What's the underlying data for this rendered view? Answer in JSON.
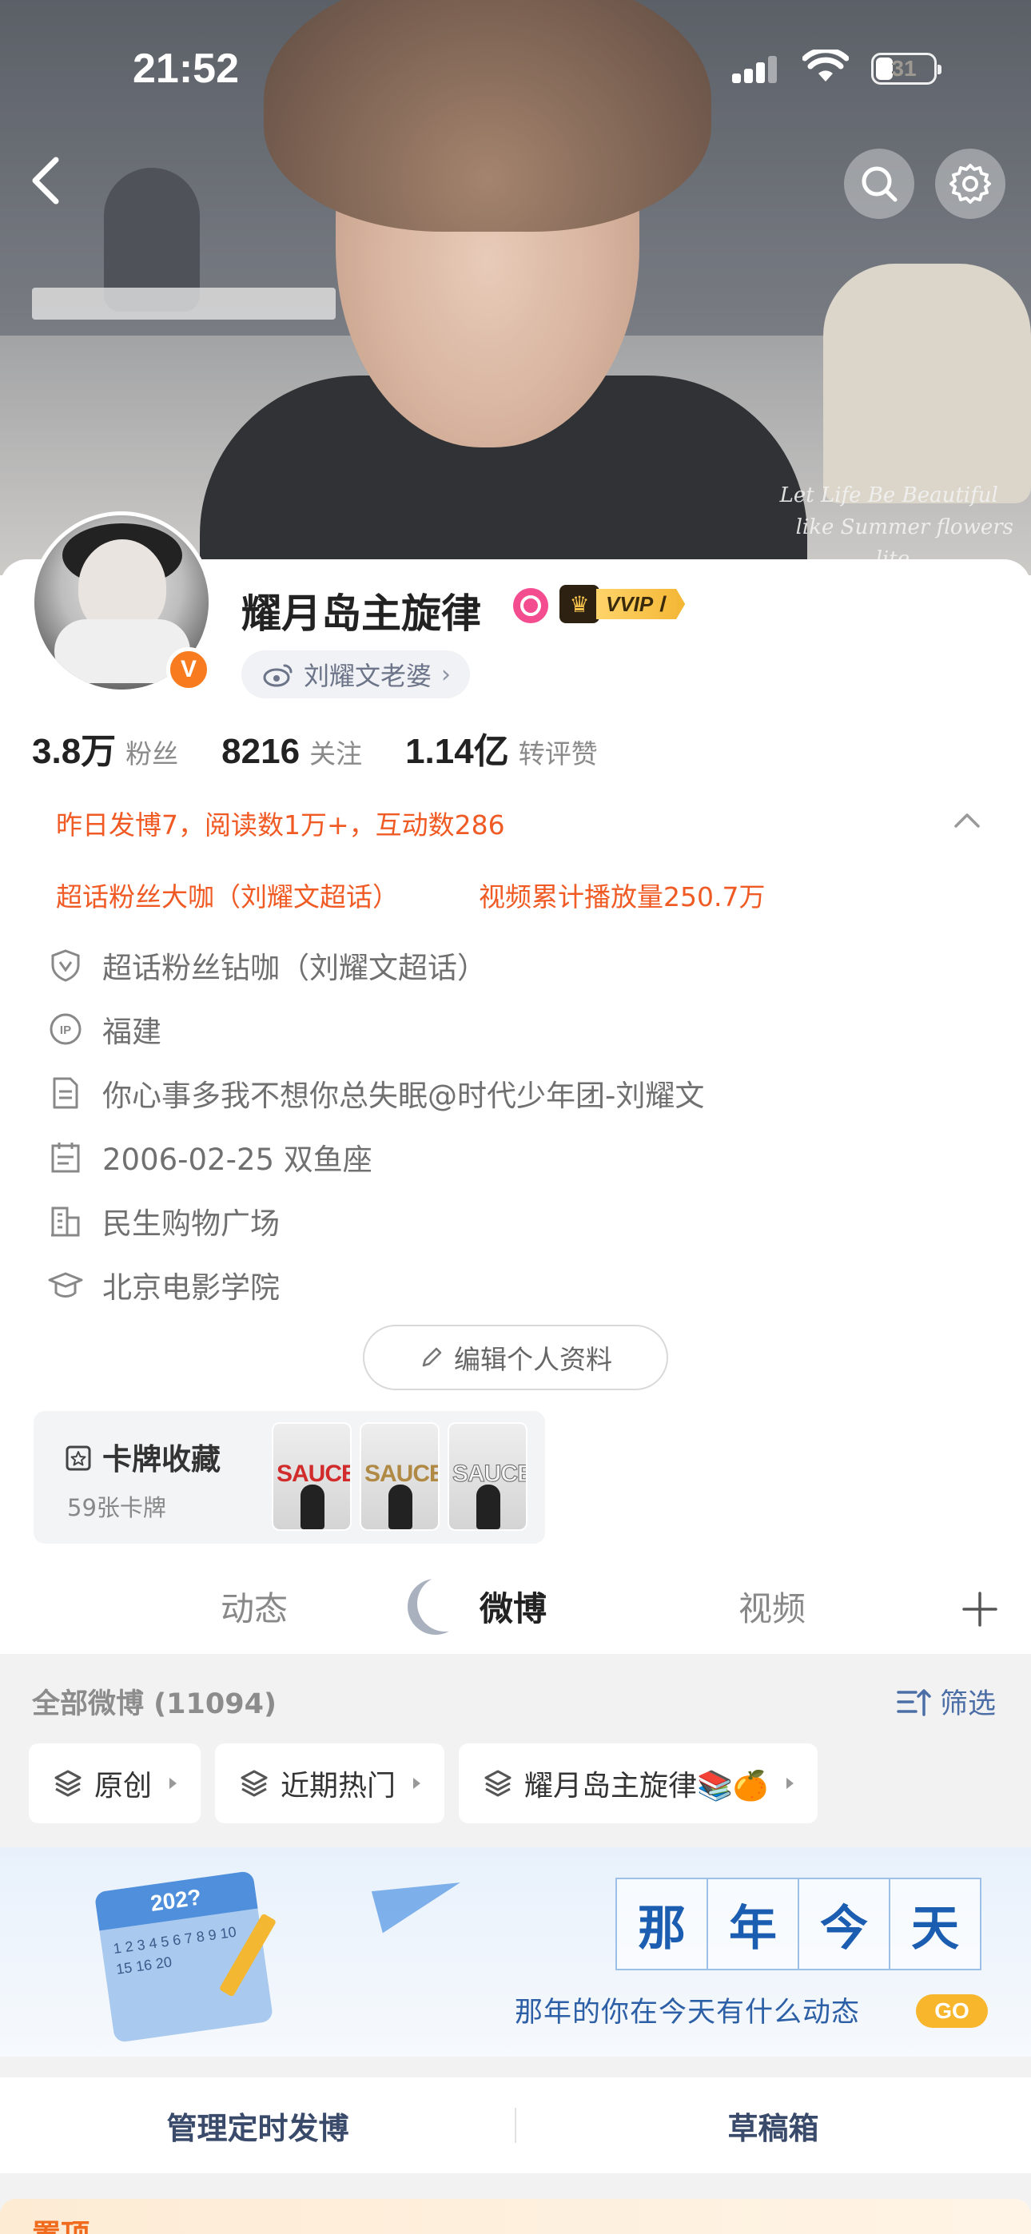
{
  "status_bar": {
    "time": "21:52",
    "battery": "31"
  },
  "cover": {
    "script_text": [
      "Let Life Be Beautiful",
      "like Summer flowers",
      "lite"
    ]
  },
  "profile": {
    "name": "耀月岛主旋律",
    "vip_label": "VVIP Ⅰ",
    "super_topic_tag": "刘耀文老婆",
    "verified_badge": "V",
    "stats": [
      {
        "num": "3.8万",
        "label": "粉丝"
      },
      {
        "num": "8216",
        "label": "关注"
      },
      {
        "num": "1.14亿",
        "label": "转评赞"
      }
    ],
    "yesterday_summary": "昨日发博7，阅读数1万+，互动数286",
    "highlights": [
      "超话粉丝大咖（刘耀文超话）",
      "视频累计播放量250.7万"
    ],
    "info_rows": [
      {
        "icon": "shield-v-icon",
        "text": "超话粉丝钻咖（刘耀文超话）"
      },
      {
        "icon": "ip-location-icon",
        "text": "福建"
      },
      {
        "icon": "bio-document-icon",
        "text": "你心事多我不想你总失眠@时代少年团-刘耀文"
      },
      {
        "icon": "birthday-calendar-icon",
        "text": "2006-02-25 双鱼座"
      },
      {
        "icon": "company-building-icon",
        "text": "民生购物广场"
      },
      {
        "icon": "school-cap-icon",
        "text": "北京电影学院"
      }
    ],
    "edit_label": "编辑个人资料"
  },
  "cards": {
    "title": "卡牌收藏",
    "count": "59张卡牌",
    "thumbs": [
      "SAUCE",
      "SAUCE",
      "SAUCE"
    ]
  },
  "tabs": {
    "items": [
      "动态",
      "微博",
      "视频"
    ],
    "active": "微博"
  },
  "feed": {
    "all_label": "全部微博 (11094)",
    "filter_label": "筛选",
    "chips": [
      "原创",
      "近期热门",
      "耀月岛主旋律📚🍊"
    ]
  },
  "banner": {
    "calendar_year": "202?",
    "calendar_nums": "1 2 3 4 5 6 7 8 9 10 15 16 20",
    "title_chars": [
      "那",
      "年",
      "今",
      "天"
    ],
    "caption": "那年的你在今天有什么动态",
    "go_label": "GO"
  },
  "manage": {
    "left": "管理定时发博",
    "right": "草稿箱"
  },
  "pinned": {
    "label": "置顶"
  },
  "colors": {
    "accent_orange": "#f05a24",
    "link_blue": "#4c6ea6",
    "vip_gold": "#f3b633"
  }
}
